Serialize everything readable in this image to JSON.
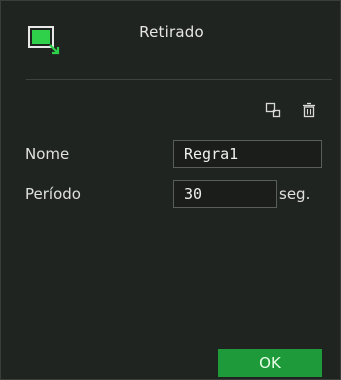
{
  "dialog": {
    "title": "Retirado"
  },
  "toolbar": {
    "copy_icon": "copy-icon",
    "delete_icon": "trash-icon"
  },
  "form": {
    "name_label": "Nome",
    "name_value": "Regra1",
    "period_label": "Período",
    "period_value": "30",
    "period_unit": "seg."
  },
  "footer": {
    "ok_label": "OK"
  },
  "colors": {
    "accent": "#1f9a3b",
    "icon_green": "#2fd14a",
    "background": "#202420"
  }
}
